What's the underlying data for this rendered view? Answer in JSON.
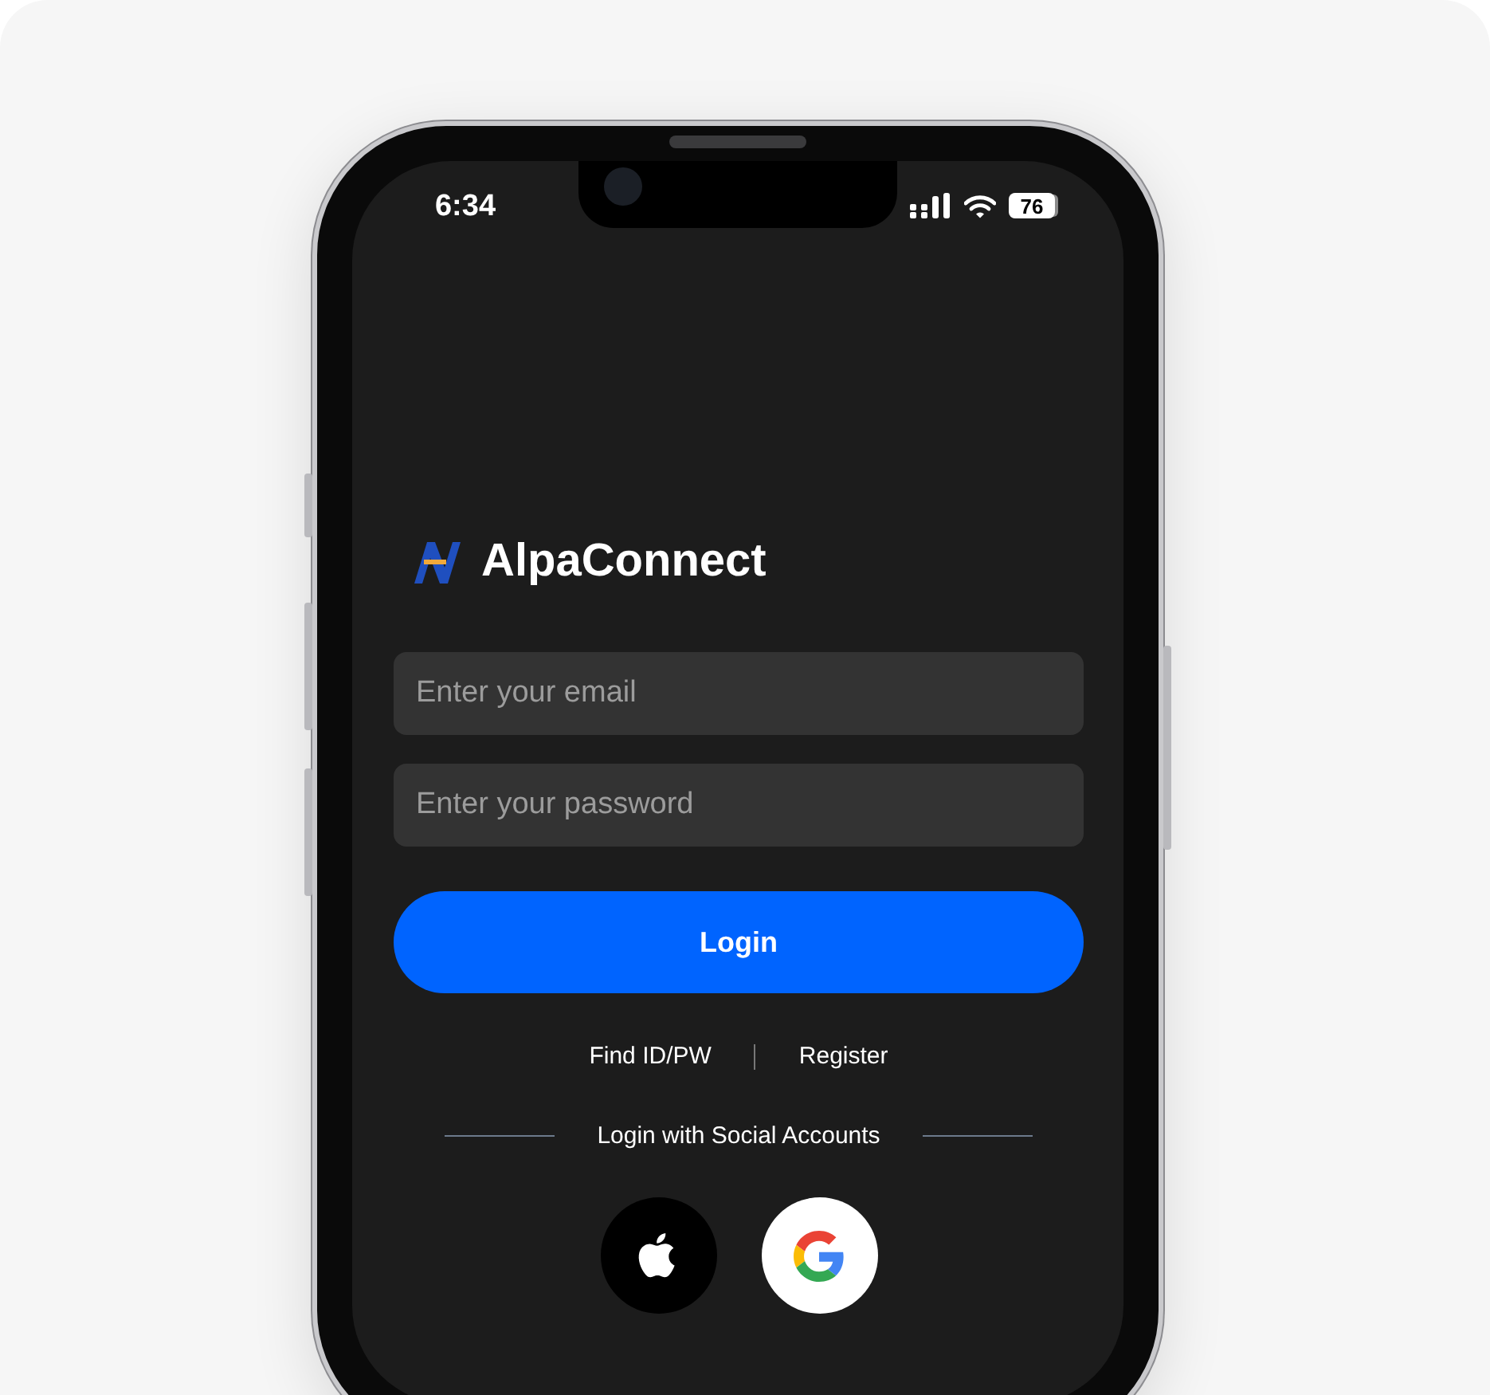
{
  "status_bar": {
    "time": "6:34",
    "battery": "76"
  },
  "app": {
    "name": "AlpaConnect"
  },
  "fields": [
    {
      "placeholder": "Enter your email"
    },
    {
      "placeholder": "Enter your password"
    }
  ],
  "login_button": "Login",
  "links": [
    "Find ID/PW",
    "Register"
  ],
  "social": {
    "label": "Login with Social Accounts",
    "buttons": [
      {
        "kind": "apple"
      },
      {
        "kind": "google"
      }
    ]
  }
}
